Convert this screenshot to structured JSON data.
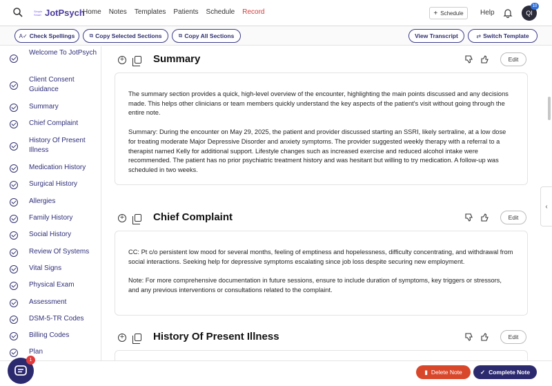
{
  "nav": {
    "logo_tiny": "Simple Smart",
    "brand": "JotPsych",
    "links": [
      "Home",
      "Notes",
      "Templates",
      "Patients",
      "Schedule",
      "Record"
    ],
    "schedule_button": "Schedule",
    "help": "Help",
    "avatar_initials": "QI",
    "avatar_badge": "10"
  },
  "toolbar": {
    "check_spellings": "Check Spellings",
    "copy_selected": "Copy Selected Sections",
    "copy_all": "Copy All Sections",
    "view_transcript": "View Transcript",
    "switch_template": "Switch Template"
  },
  "sidebar": {
    "items": [
      "Welcome To JotPsych",
      "Client Consent Guidance",
      "Summary",
      "Chief Complaint",
      "History Of Present Illness",
      "Medication History",
      "Surgical History",
      "Allergies",
      "Family History",
      "Social History",
      "Review Of Systems",
      "Vital Signs",
      "Physical Exam",
      "Assessment",
      "DSM-5-TR Codes",
      "Billing Codes",
      "Plan"
    ]
  },
  "sections": {
    "summary": {
      "title": "Summary",
      "edit": "Edit",
      "p1": "The summary section provides a quick, high-level overview of the encounter, highlighting the main points discussed and any decisions made. This helps other clinicians or team members quickly understand the key aspects of the patient's visit without going through the entire note.",
      "p2": "Summary: During the encounter on May 29, 2025, the patient and provider discussed starting an SSRI, likely sertraline, at a low dose for treating moderate Major Depressive Disorder and anxiety symptoms. The provider suggested weekly therapy with a referral to a therapist named Kelly for additional support. Lifestyle changes such as increased exercise and reduced alcohol intake were recommended. The patient has no prior psychiatric treatment history and was hesitant but willing to try medication. A follow-up was scheduled in two weeks."
    },
    "chief_complaint": {
      "title": "Chief Complaint",
      "edit": "Edit",
      "p1": "CC: Pt c/o persistent low mood for several months, feeling of emptiness and hopelessness, difficulty concentrating, and withdrawal from social interactions. Seeking help for depressive symptoms escalating since job loss despite securing new employment.",
      "p2": "Note: For more comprehensive documentation in future sessions, ensure to include duration of symptoms, key triggers or stressors, and any previous interventions or consultations related to the complaint."
    },
    "hpi": {
      "title": "History Of Present Illness",
      "edit": "Edit"
    }
  },
  "footer": {
    "chat_badge": "1",
    "delete_note": "Delete Note",
    "complete_note": "Complete Note"
  },
  "colors": {
    "primary": "#2c2a6e",
    "record": "#d43b3b",
    "delete": "#d9472b",
    "badge": "#2f6fd6"
  }
}
